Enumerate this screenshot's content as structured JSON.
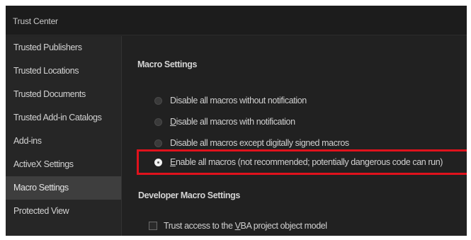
{
  "window": {
    "title": "Trust Center"
  },
  "sidebar": {
    "items": [
      {
        "label": "Trusted Publishers",
        "active": false
      },
      {
        "label": "Trusted Locations",
        "active": false
      },
      {
        "label": "Trusted Documents",
        "active": false
      },
      {
        "label": "Trusted Add-in Catalogs",
        "active": false
      },
      {
        "label": "Add-ins",
        "active": false
      },
      {
        "label": "ActiveX Settings",
        "active": false
      },
      {
        "label": "Macro Settings",
        "active": true
      },
      {
        "label": "Protected View",
        "active": false
      }
    ]
  },
  "macro_settings": {
    "heading": "Macro Settings",
    "options": [
      {
        "label": "Disable all macros without notification",
        "checked": false,
        "accesskey": ""
      },
      {
        "label_key": "D",
        "label_rest": "isable all macros with notification",
        "checked": false
      },
      {
        "label": "Disable all macros except digitally signed macros",
        "checked": false
      },
      {
        "label_key": "E",
        "label_rest": "nable all macros (not recommended; potentially dangerous code can run)",
        "checked": true
      }
    ],
    "highlight_color": "#e0121c"
  },
  "developer_settings": {
    "heading": "Developer Macro Settings",
    "vba_checkbox": {
      "label_before": "Trust access to the ",
      "label_key": "V",
      "label_after": "BA project object model",
      "checked": false
    }
  }
}
